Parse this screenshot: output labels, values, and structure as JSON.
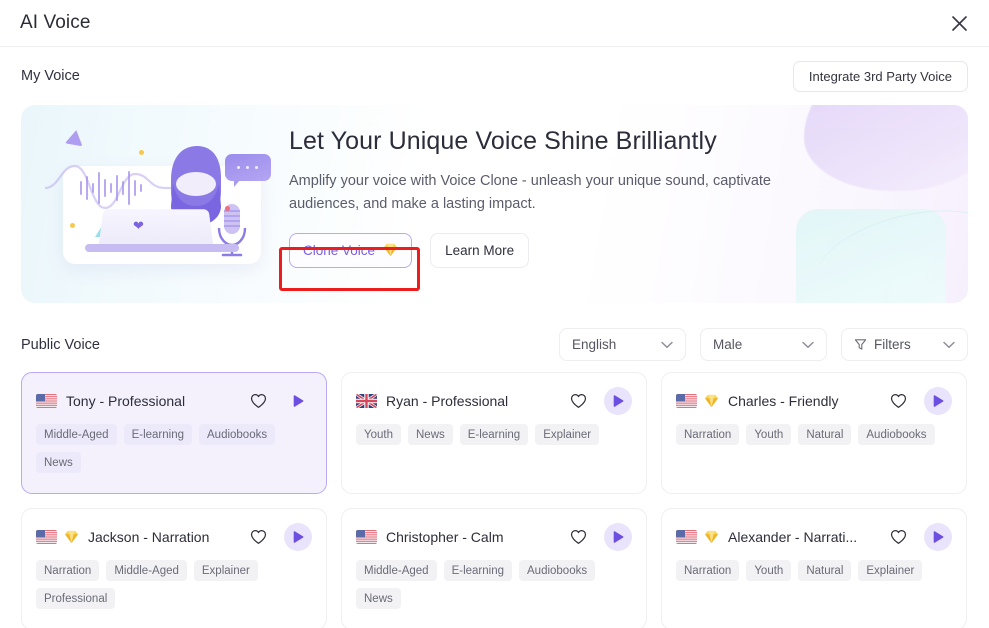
{
  "window": {
    "title": "AI Voice",
    "close_icon": "close-icon"
  },
  "my_voice": {
    "title": "My Voice",
    "integrate_button": "Integrate 3rd Party Voice"
  },
  "banner": {
    "heading": "Let Your Unique Voice Shine Brilliantly",
    "description": "Amplify your voice with Voice Clone - unleash your unique sound, captivate audiences, and make a lasting impact.",
    "clone_button": "Clone Voice",
    "clone_button_icon": "gem-icon",
    "learn_button": "Learn More",
    "highlight_color": "#ee1d1d"
  },
  "public_voice": {
    "title": "Public Voice",
    "filters": [
      {
        "name": "language",
        "value": "English",
        "icon": "chevron-down-icon"
      },
      {
        "name": "gender",
        "value": "Male",
        "icon": "chevron-down-icon"
      },
      {
        "name": "filters",
        "value": "Filters",
        "icon": "filter-icon"
      }
    ],
    "cards": [
      {
        "name": "Tony - Professional",
        "flag": "us-flag-icon",
        "premium": false,
        "selected": true,
        "tags": [
          "Middle-Aged",
          "E-learning",
          "Audiobooks",
          "News"
        ]
      },
      {
        "name": "Ryan - Professional",
        "flag": "uk-flag-icon",
        "premium": false,
        "selected": false,
        "tags": [
          "Youth",
          "News",
          "E-learning",
          "Explainer"
        ]
      },
      {
        "name": "Charles - Friendly",
        "flag": "us-flag-icon",
        "premium": true,
        "selected": false,
        "tags": [
          "Narration",
          "Youth",
          "Natural",
          "Audiobooks"
        ]
      },
      {
        "name": "Jackson - Narration",
        "flag": "us-flag-icon",
        "premium": true,
        "selected": false,
        "tags": [
          "Narration",
          "Middle-Aged",
          "Explainer",
          "Professional"
        ]
      },
      {
        "name": "Christopher - Calm",
        "flag": "us-flag-icon",
        "premium": false,
        "selected": false,
        "tags": [
          "Middle-Aged",
          "E-learning",
          "Audiobooks",
          "News"
        ]
      },
      {
        "name": "Alexander - Narrati...",
        "flag": "us-flag-icon",
        "premium": true,
        "selected": false,
        "tags": [
          "Narration",
          "Youth",
          "Natural",
          "Explainer"
        ]
      }
    ]
  },
  "colors": {
    "accent": "#6c4fe0",
    "accent_light": "#e9e3fb",
    "selected_bg": "#f4f1fd",
    "highlight": "#ee1d1d",
    "gem": "#f5c23c"
  }
}
